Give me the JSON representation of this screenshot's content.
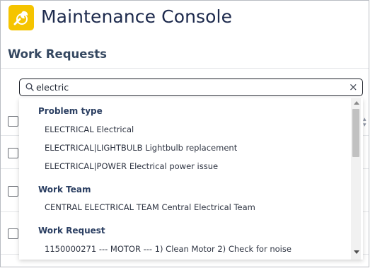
{
  "header": {
    "title": "Maintenance Console",
    "logo_icon": "wrench-icon",
    "logo_color": "#f5c400"
  },
  "section": {
    "title": "Work Requests"
  },
  "search": {
    "value": "electric",
    "clear_symbol": "×"
  },
  "dropdown": {
    "groups": [
      {
        "heading": "Problem type",
        "options": [
          "ELECTRICAL Electrical",
          "ELECTRICAL|LIGHTBULB Lightbulb replacement",
          "ELECTRICAL|POWER Electrical power issue"
        ]
      },
      {
        "heading": "Work Team",
        "options": [
          "CENTRAL ELECTRICAL TEAM Central Electrical Team"
        ]
      },
      {
        "heading": "Work Request",
        "options": [
          "1150000271 --- MOTOR --- 1) Clean Motor 2) Check for noise"
        ]
      }
    ]
  }
}
